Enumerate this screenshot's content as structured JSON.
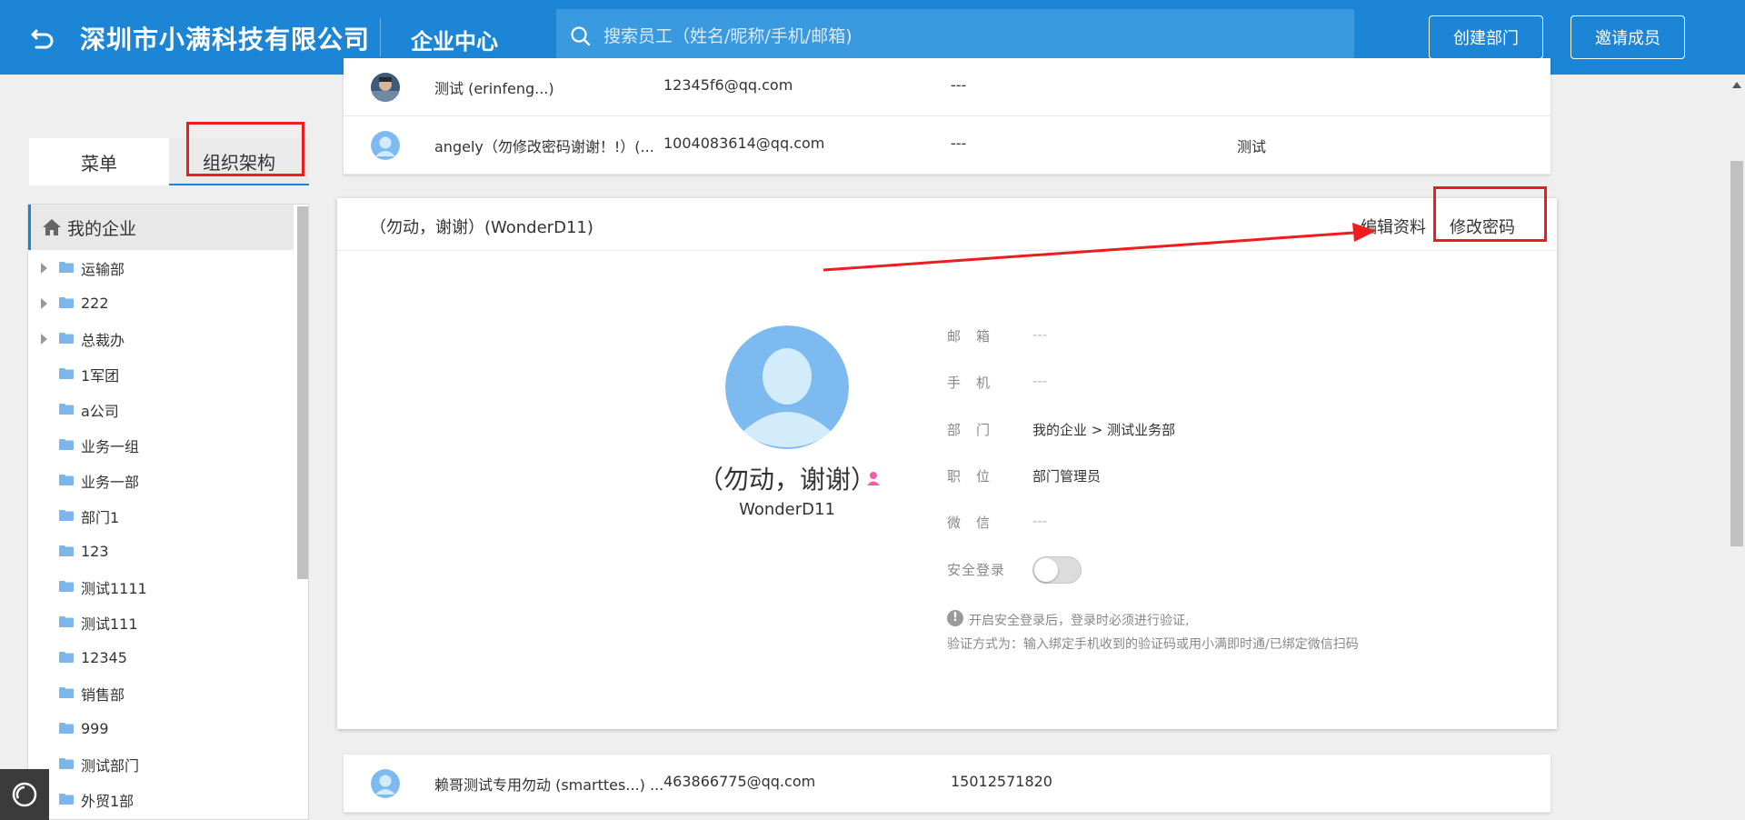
{
  "header": {
    "company": "深圳市小满科技有限公司",
    "section_title": "企业中心",
    "search_placeholder": "搜索员工（姓名/昵称/手机/邮箱)",
    "create_dept_label": "创建部门",
    "invite_label": "邀请成员",
    "bg_color": "#1c85d6"
  },
  "left_tabs": {
    "menu": "菜单",
    "org": "组织架构"
  },
  "tree": {
    "root": "我的企业",
    "items": [
      {
        "label": "运输部",
        "expandable": true
      },
      {
        "label": "222",
        "expandable": true
      },
      {
        "label": "总裁办",
        "expandable": true
      },
      {
        "label": "1军团",
        "expandable": false
      },
      {
        "label": "a公司",
        "expandable": false
      },
      {
        "label": "业务一组",
        "expandable": false
      },
      {
        "label": "业务一部",
        "expandable": false
      },
      {
        "label": "部门1",
        "expandable": false
      },
      {
        "label": "123",
        "expandable": false
      },
      {
        "label": "测试1111",
        "expandable": false
      },
      {
        "label": "测试111",
        "expandable": false
      },
      {
        "label": "12345",
        "expandable": false
      },
      {
        "label": "销售部",
        "expandable": false
      },
      {
        "label": "999",
        "expandable": false
      },
      {
        "label": "测试部门",
        "expandable": false
      },
      {
        "label": "外贸1部",
        "expandable": false
      }
    ]
  },
  "employees_top": [
    {
      "name": "测试 (erinfeng...)",
      "email": "12345f6@qq.com",
      "phone": "---",
      "dept": ""
    },
    {
      "name": "angely（勿修改密码谢谢！!）(...",
      "email": "1004083614@qq.com",
      "phone": "---",
      "dept": "测试"
    }
  ],
  "detail": {
    "header_title": "（勿动，谢谢）(WonderD11)",
    "edit_label": "编辑资料",
    "change_pwd_label": "修改密码",
    "display_name": "（勿动，谢谢）",
    "account_id": "WonderD11",
    "fields": {
      "email_label": "邮　箱",
      "email_value": "---",
      "phone_label": "手　机",
      "phone_value": "---",
      "dept_label": "部　门",
      "dept_value": "我的企业 > 测试业务部",
      "position_label": "职　位",
      "position_value": "部门管理员",
      "wechat_label": "微　信",
      "wechat_value": "---",
      "secure_login_label": "安全登录"
    },
    "secure_login_enabled": false,
    "note_line1": "开启安全登录后，登录时必须进行验证,",
    "note_line2": "验证方式为：输入绑定手机收到的验证码或用小满即时通/已绑定微信扫码"
  },
  "employees_bottom": [
    {
      "name": "赖哥测试专用勿动 (smarttes...) ...",
      "email": "463866775@qq.com",
      "phone": "15012571820",
      "dept": ""
    }
  ],
  "annotation_color": "#ee1c1c"
}
